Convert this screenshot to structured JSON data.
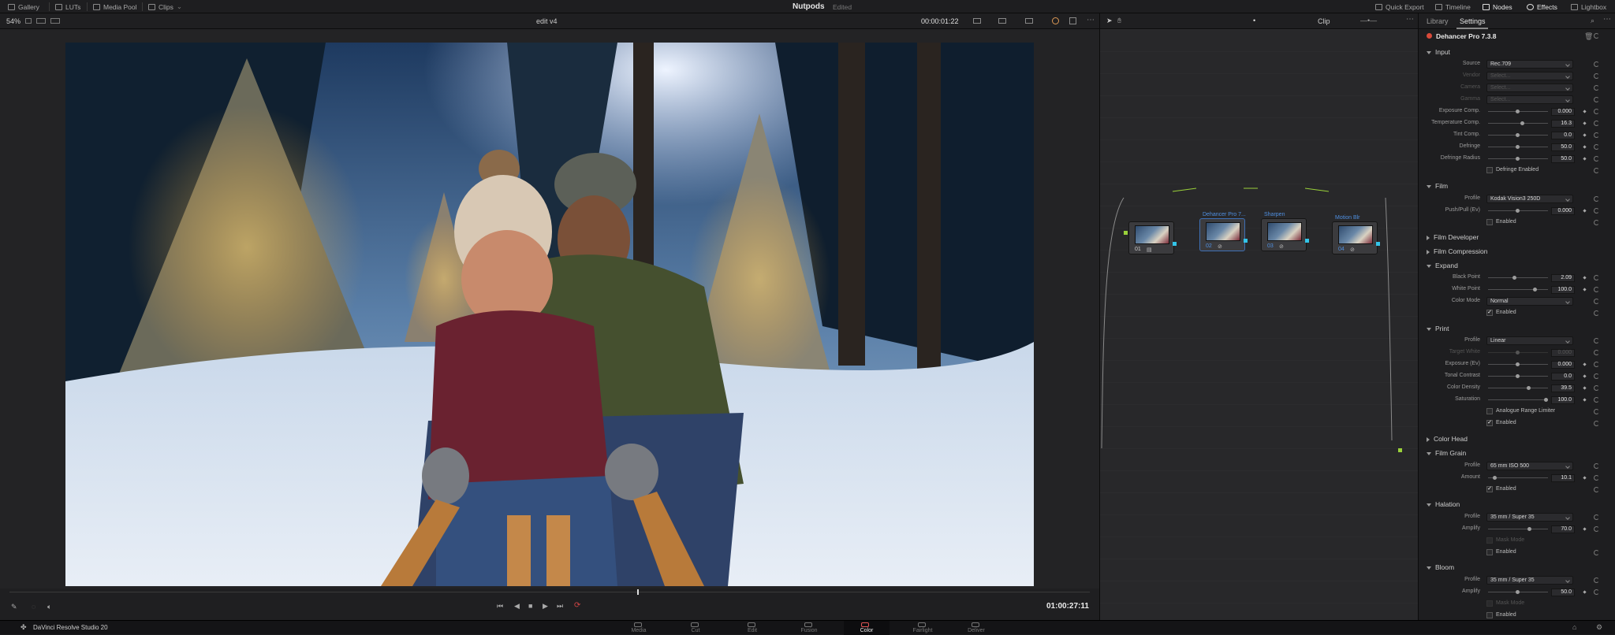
{
  "topbar": {
    "left_items": [
      "Gallery",
      "LUTs",
      "Media Pool",
      "Clips"
    ],
    "project": "Nutpods",
    "project_status": "Edited",
    "right_items": [
      "Quick Export",
      "Timeline",
      "Nodes",
      "Effects",
      "Lightbox"
    ]
  },
  "viewer": {
    "zoom": "54%",
    "timeline_name": "edit v4",
    "clip_timecode": "00:00:01:22",
    "record_timecode": "01:00:27:11"
  },
  "nodes_toolbar": {
    "mode": "Clip"
  },
  "nodes": [
    {
      "label": "",
      "num": "01"
    },
    {
      "label": "Dehancer Pro 7...",
      "num": "02"
    },
    {
      "label": "Sharpen",
      "num": "03"
    },
    {
      "label": "Motion Blr",
      "num": "04"
    }
  ],
  "inspector": {
    "tabs": [
      "Library",
      "Settings"
    ],
    "plugin_title": "Dehancer Pro 7.3.8",
    "sections": {
      "input": "Input",
      "film": "Film",
      "film_developer": "Film Developer",
      "film_compression": "Film Compression",
      "expand": "Expand",
      "print": "Print",
      "color_head": "Color Head",
      "film_grain": "Film Grain",
      "halation": "Halation",
      "bloom": "Bloom"
    },
    "input": {
      "source_label": "Source",
      "source_value": "Rec.709",
      "vendor_label": "Vendor",
      "vendor_value": "Select...",
      "camera_label": "Camera",
      "camera_value": "Select...",
      "gamma_label": "Gamma",
      "gamma_value": "Select...",
      "exposure_label": "Exposure Comp.",
      "exposure_value": "0.000",
      "temperature_label": "Temperature Comp.",
      "temperature_value": "16.3",
      "tint_label": "Tint Comp.",
      "tint_value": "0.0",
      "defringe_label": "Defringe",
      "defringe_value": "50.0",
      "defringe_radius_label": "Defringe Radius",
      "defringe_radius_value": "50.0",
      "defringe_enabled_label": "Defringe Enabled"
    },
    "film": {
      "profile_label": "Profile",
      "profile_value": "Kodak Vision3 250D",
      "pushpull_label": "Push/Pull (Ev)",
      "pushpull_value": "0.000",
      "enabled_label": "Enabled"
    },
    "expand": {
      "black_label": "Black Point",
      "black_value": "2.09",
      "white_label": "White Point",
      "white_value": "100.0",
      "mode_label": "Color Mode",
      "mode_value": "Normal",
      "enabled_label": "Enabled"
    },
    "print": {
      "profile_label": "Profile",
      "profile_value": "Linear",
      "target_label": "Target White",
      "target_value": "0.000",
      "exposure_label": "Exposure (Ev)",
      "exposure_value": "0.000",
      "tonal_label": "Tonal Contrast",
      "tonal_value": "0.0",
      "density_label": "Color Density",
      "density_value": "39.5",
      "saturation_label": "Saturation",
      "saturation_value": "100.0",
      "limiter_label": "Analogue Range Limiter",
      "enabled_label": "Enabled"
    },
    "film_grain": {
      "profile_label": "Profile",
      "profile_value": "65 mm ISO 500",
      "amount_label": "Amount",
      "amount_value": "10.1",
      "enabled_label": "Enabled"
    },
    "halation": {
      "profile_label": "Profile",
      "profile_value": "35 mm / Super 35",
      "amplify_label": "Amplify",
      "amplify_value": "70.0",
      "mask_label": "Mask Mode",
      "enabled_label": "Enabled"
    },
    "bloom": {
      "profile_label": "Profile",
      "profile_value": "35 mm / Super 35",
      "amplify_label": "Amplify",
      "amplify_value": "50.0",
      "mask_label": "Mask Mode",
      "enabled_label": "Enabled"
    }
  },
  "pages": [
    "Media",
    "Cut",
    "Edit",
    "Fusion",
    "Color",
    "Fairlight",
    "Deliver"
  ],
  "active_page": "Color",
  "app_name": "DaVinci Resolve Studio 20"
}
